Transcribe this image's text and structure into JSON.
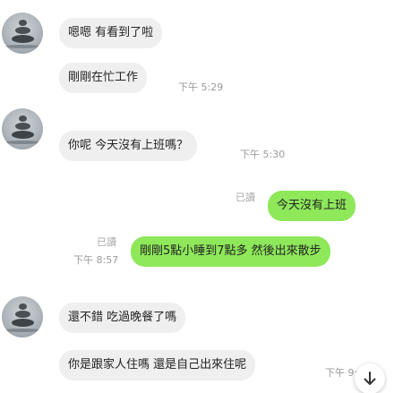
{
  "messages": [
    {
      "side": "in",
      "text": "嗯嗯 有看到了啦",
      "time": ""
    },
    {
      "side": "in",
      "text": "剛剛在忙工作",
      "time": "下午 5:29"
    },
    {
      "side": "in",
      "text": "你呢 今天沒有上班嗎？",
      "time": "下午 5:30"
    },
    {
      "side": "out",
      "text": "今天沒有上班",
      "read": "已讀",
      "time": ""
    },
    {
      "side": "out",
      "text": "剛剛5點小睡到7點多 然後出來散步",
      "read": "已讀",
      "time": "下午 8:57"
    },
    {
      "side": "in",
      "text": "還不錯 吃過晚餐了嗎",
      "time": ""
    },
    {
      "side": "in",
      "text": "你是跟家人住嗎 還是自己出來住呢",
      "time": "下午 9:"
    }
  ],
  "colors": {
    "incoming_bubble": "#efefef",
    "outgoing_bubble": "#8ee85a",
    "meta_text": "#9a9a9a"
  },
  "icons": {
    "avatar": "stacked-stones-avatar",
    "scroll_down": "arrow-down-icon"
  }
}
